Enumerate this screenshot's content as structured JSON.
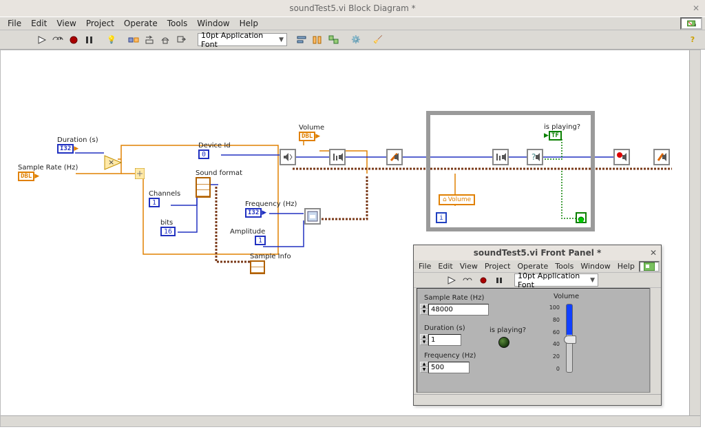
{
  "window": {
    "title": "soundTest5.vi Block Diagram *"
  },
  "menu": [
    "File",
    "Edit",
    "View",
    "Project",
    "Operate",
    "Tools",
    "Window",
    "Help"
  ],
  "toolbar": {
    "font": "10pt Application Font"
  },
  "diagram": {
    "duration": {
      "label": "Duration (s)",
      "type": "I32"
    },
    "sample_rate": {
      "label": "Sample Rate (Hz)",
      "type": "DBL"
    },
    "channels": {
      "label": "Channels",
      "value": "1"
    },
    "bits": {
      "label": "bits",
      "value": "16"
    },
    "device_id": {
      "label": "Device Id",
      "value": "0"
    },
    "sound_format": {
      "label": "Sound format"
    },
    "frequency": {
      "label": "Frequency (Hz)",
      "type": "I32"
    },
    "amplitude": {
      "label": "Amplitude",
      "value": "1"
    },
    "sample_info": {
      "label": "Sample Info"
    },
    "volume": {
      "label": "Volume",
      "type": "DBL"
    },
    "volume_local": {
      "label": "Volume"
    },
    "is_playing": {
      "label": "is playing?",
      "type": "TF"
    },
    "loop_i": "i"
  },
  "front_panel": {
    "title": "soundTest5.vi Front Panel *",
    "menu": [
      "File",
      "Edit",
      "View",
      "Project",
      "Operate",
      "Tools",
      "Window",
      "Help"
    ],
    "font": "10pt Application Font",
    "sample_rate": {
      "label": "Sample Rate (Hz)",
      "value": "48000"
    },
    "duration": {
      "label": "Duration (s)",
      "value": "1"
    },
    "frequency": {
      "label": "Frequency (Hz)",
      "value": "500"
    },
    "is_playing": {
      "label": "is playing?"
    },
    "volume": {
      "label": "Volume",
      "ticks": [
        "100",
        "80",
        "60",
        "40",
        "20",
        "0"
      ]
    }
  }
}
